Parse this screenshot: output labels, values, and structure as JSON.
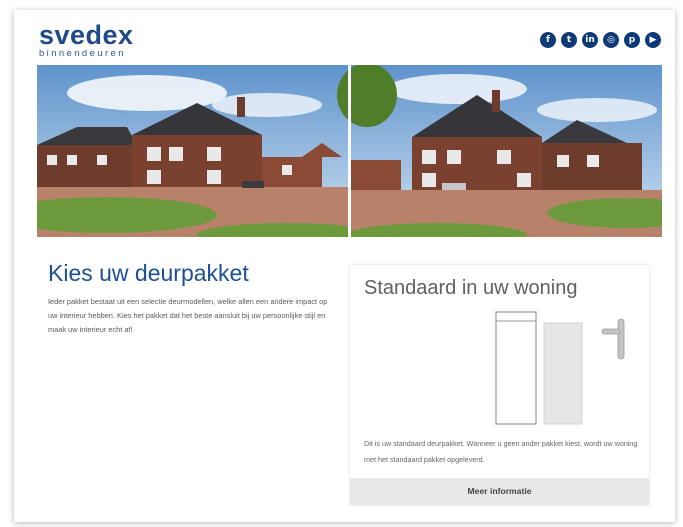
{
  "header": {
    "brand": "svedex",
    "tagline": "binnendeuren",
    "social_icons": [
      {
        "name": "facebook-icon",
        "glyph": "f"
      },
      {
        "name": "twitter-icon",
        "glyph": "t"
      },
      {
        "name": "linkedin-icon",
        "glyph": "in"
      },
      {
        "name": "instagram-icon",
        "glyph": "◎"
      },
      {
        "name": "pinterest-icon",
        "glyph": "p"
      },
      {
        "name": "youtube-icon",
        "glyph": "▶"
      }
    ],
    "brand_color": "#1f4a8a"
  },
  "main": {
    "headline": "Kies uw deurpakket",
    "intro": "Ieder pakket bestaat uit een selectie deurmodellen, welke allen een andere impact op uw interieur hebben. Kies het pakket dat het beste aansluit bij uw persoonlijke stijl en maak uw interieur echt af!"
  },
  "package": {
    "title": "Standaard in uw woning",
    "description": "Dit is uw standaard deurpakket. Wanneer u geen ander pakket kiest, wordt uw woning met het standaard pakket opgeleverd.",
    "button_label": "Meer informatie"
  }
}
